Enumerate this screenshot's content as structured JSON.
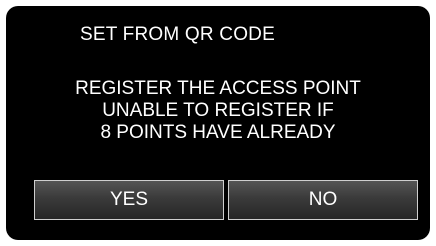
{
  "screen": {
    "title": "SET FROM QR CODE",
    "message_lines": [
      "REGISTER THE ACCESS POINT",
      "UNABLE TO REGISTER IF",
      "8 POINTS HAVE ALREADY"
    ]
  },
  "buttons": {
    "yes_label": "YES",
    "no_label": "NO"
  },
  "colors": {
    "background": "#000000",
    "text": "#ffffff",
    "button_border": "#cfcfcf"
  }
}
